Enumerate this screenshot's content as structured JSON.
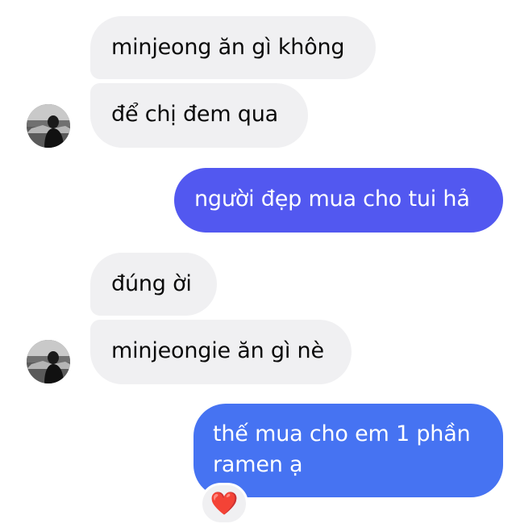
{
  "conversation": {
    "messages": [
      {
        "sender": "them",
        "text": "minjeong ăn gì không"
      },
      {
        "sender": "them",
        "text": "để chị đem qua"
      },
      {
        "sender": "me",
        "text": "người đẹp mua cho tui hả"
      },
      {
        "sender": "them",
        "text": "đúng ời"
      },
      {
        "sender": "them",
        "text": "minjeongie ăn gì nè"
      },
      {
        "sender": "me",
        "text_line1": "thế mua cho em 1 phần",
        "text_line2": "ramen ạ",
        "reaction": "❤️"
      }
    ]
  },
  "colors": {
    "incoming_bubble": "#f0f0f2",
    "outgoing_bubble_purple": "#5258f0",
    "outgoing_bubble_blue": "#4673f2"
  },
  "icons": {
    "avatar": "contact-avatar-icon",
    "reaction": "heart-reaction-icon"
  }
}
